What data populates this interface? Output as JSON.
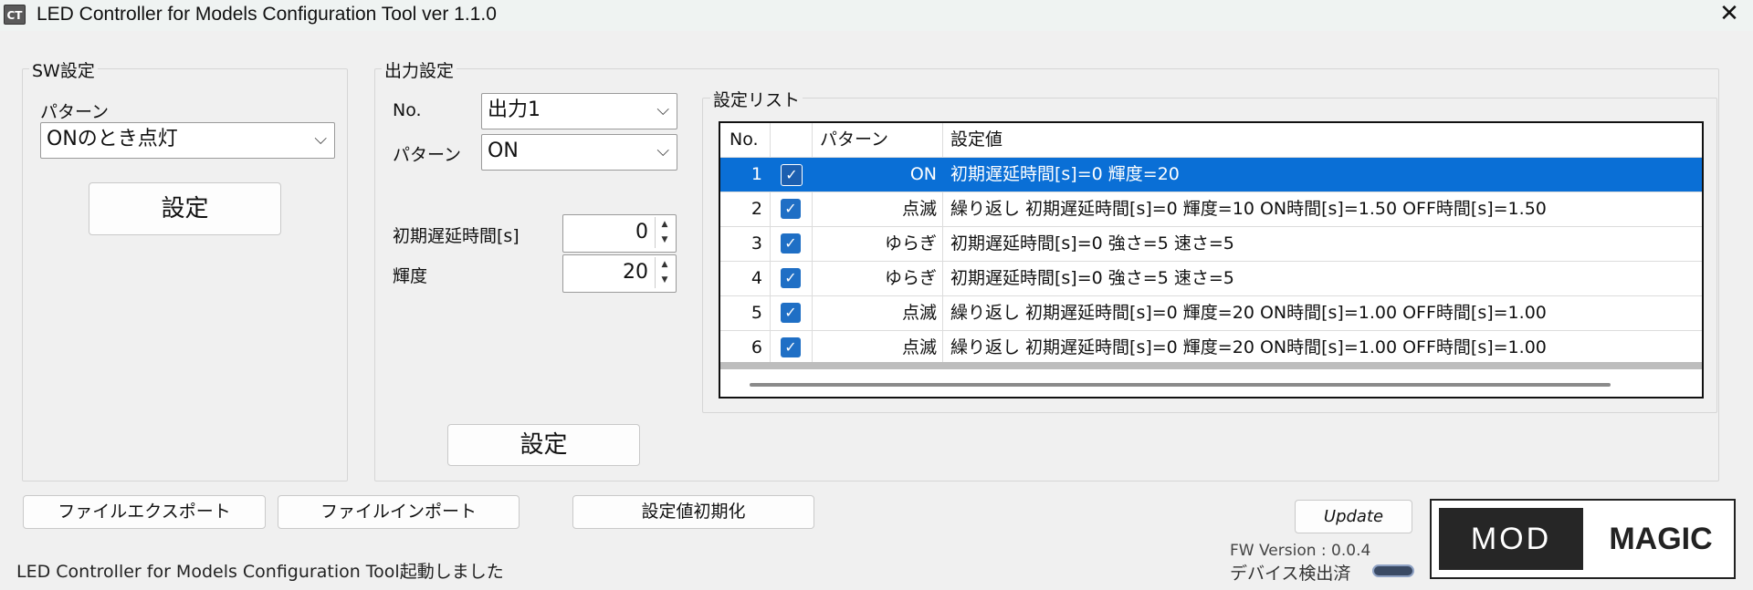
{
  "window": {
    "title": "LED Controller for Models Configuration Tool ver 1.1.0",
    "app_icon": "CT",
    "close_glyph": "✕"
  },
  "sw_settings": {
    "group_label": "SW設定",
    "pattern_label": "パターン",
    "pattern_value": "ONのとき点灯",
    "set_button": "設定"
  },
  "output_settings": {
    "group_label": "出力設定",
    "no_label": "No.",
    "no_value": "出力1",
    "pattern_label": "パターン",
    "pattern_value": "ON",
    "delay_label": "初期遅延時間[s]",
    "delay_value": "0",
    "brightness_label": "輝度",
    "brightness_value": "20",
    "set_button": "設定"
  },
  "settings_list": {
    "group_label": "設定リスト",
    "columns": [
      "No.",
      "",
      "パターン",
      "設定値"
    ],
    "rows": [
      {
        "no": "1",
        "checked": true,
        "pattern": "ON",
        "value": "初期遅延時間[s]=0 輝度=20",
        "selected": true
      },
      {
        "no": "2",
        "checked": true,
        "pattern": "点滅",
        "value": "繰り返し 初期遅延時間[s]=0 輝度=10 ON時間[s]=1.50 OFF時間[s]=1.50",
        "selected": false
      },
      {
        "no": "3",
        "checked": true,
        "pattern": "ゆらぎ",
        "value": "初期遅延時間[s]=0 強さ=5 速さ=5",
        "selected": false
      },
      {
        "no": "4",
        "checked": true,
        "pattern": "ゆらぎ",
        "value": "初期遅延時間[s]=0 強さ=5 速さ=5",
        "selected": false
      },
      {
        "no": "5",
        "checked": true,
        "pattern": "点滅",
        "value": "繰り返し 初期遅延時間[s]=0 輝度=20 ON時間[s]=1.00 OFF時間[s]=1.00",
        "selected": false
      },
      {
        "no": "6",
        "checked": true,
        "pattern": "点滅",
        "value": "繰り返し 初期遅延時間[s]=0 輝度=20 ON時間[s]=1.00 OFF時間[s]=1.00",
        "selected": false
      }
    ]
  },
  "bottom": {
    "export_button": "ファイルエクスポート",
    "import_button": "ファイルインポート",
    "reset_button": "設定値初期化",
    "update_button": "Update",
    "status_text": "LED Controller for Models Configuration Tool起動しました",
    "fw_version": "FW Version : 0.0.4",
    "device_status": "デバイス検出済"
  },
  "logo": {
    "left": "MOD",
    "right": "MAGIC"
  },
  "colors": {
    "selection": "#0a6fd6",
    "checkbox": "#1f6fc5",
    "window_bg": "#f0f0f0"
  }
}
